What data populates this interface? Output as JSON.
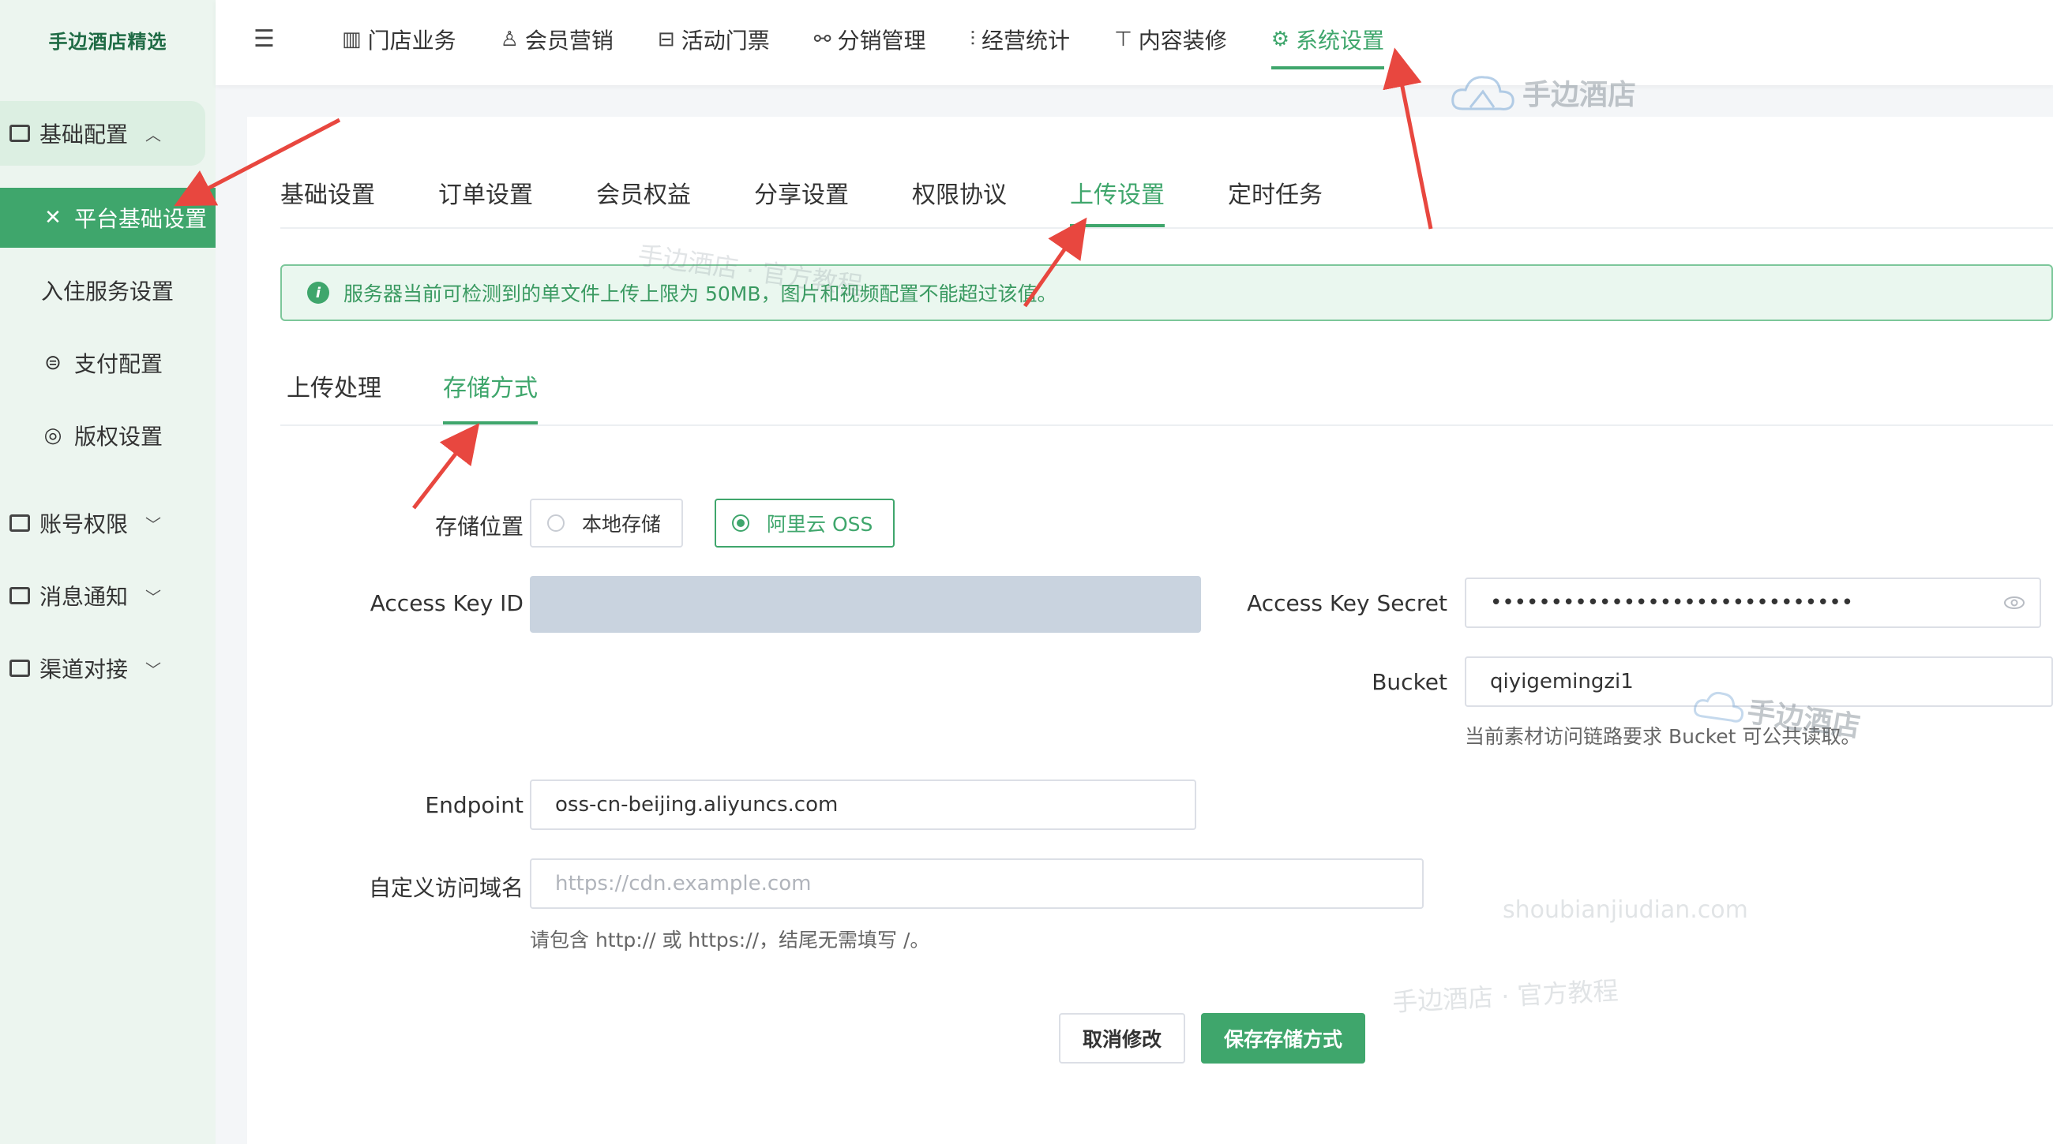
{
  "brand": "手边酒店精选",
  "sidebar": {
    "groups": [
      {
        "label": "基础配置",
        "chevron": "^"
      },
      {
        "label": "账号权限",
        "chevron": "v"
      },
      {
        "label": "消息通知",
        "chevron": "v"
      },
      {
        "label": "渠道对接",
        "chevron": "v"
      }
    ],
    "items": [
      {
        "label": "平台基础设置",
        "icon": "tools-icon"
      },
      {
        "label": "入住服务设置",
        "icon": ""
      },
      {
        "label": "支付配置",
        "icon": "payment-icon"
      },
      {
        "label": "版权设置",
        "icon": "copyright-icon"
      }
    ]
  },
  "topnav": [
    {
      "label": "门店业务",
      "icon": "store-icon"
    },
    {
      "label": "会员营销",
      "icon": "user-icon"
    },
    {
      "label": "活动门票",
      "icon": "ticket-icon"
    },
    {
      "label": "分销管理",
      "icon": "share-icon"
    },
    {
      "label": "经营统计",
      "icon": "bar-chart-icon"
    },
    {
      "label": "内容装修",
      "icon": "brush-icon"
    },
    {
      "label": "系统设置",
      "icon": "gear-icon"
    }
  ],
  "settings_tabs": [
    "基础设置",
    "订单设置",
    "会员权益",
    "分享设置",
    "权限协议",
    "上传设置",
    "定时任务"
  ],
  "alert": "服务器当前可检测到的单文件上传上限为 50MB，图片和视频配置不能超过该值。",
  "upload_tabs": [
    "上传处理",
    "存储方式"
  ],
  "form": {
    "storage_label": "存储位置",
    "storage_local": "本地存储",
    "storage_oss": "阿里云 OSS",
    "access_key_id_label": "Access Key ID",
    "access_key_id_value": "",
    "access_key_secret_label": "Access Key Secret",
    "access_key_secret_value": "••••••••••••••••••••••••••••••",
    "bucket_label": "Bucket",
    "bucket_value": "qiyigemingzi1",
    "bucket_hint": "当前素材访问链路要求 Bucket 可公共读取。",
    "endpoint_label": "Endpoint",
    "endpoint_value": "oss-cn-beijing.aliyuncs.com",
    "domain_label": "自定义访问域名",
    "domain_placeholder": "https://cdn.example.com",
    "domain_hint": "请包含 http:// 或 https://，结尾无需填写 /。",
    "cancel": "取消修改",
    "save": "保存存储方式"
  },
  "watermarks": {
    "logo_text": "手边酒店",
    "site": "shoubianjiudian.com",
    "tutorial": "手边酒店 · 官方教程"
  },
  "colors": {
    "accent": "#3fa66c",
    "arrow": "#e8473f"
  }
}
